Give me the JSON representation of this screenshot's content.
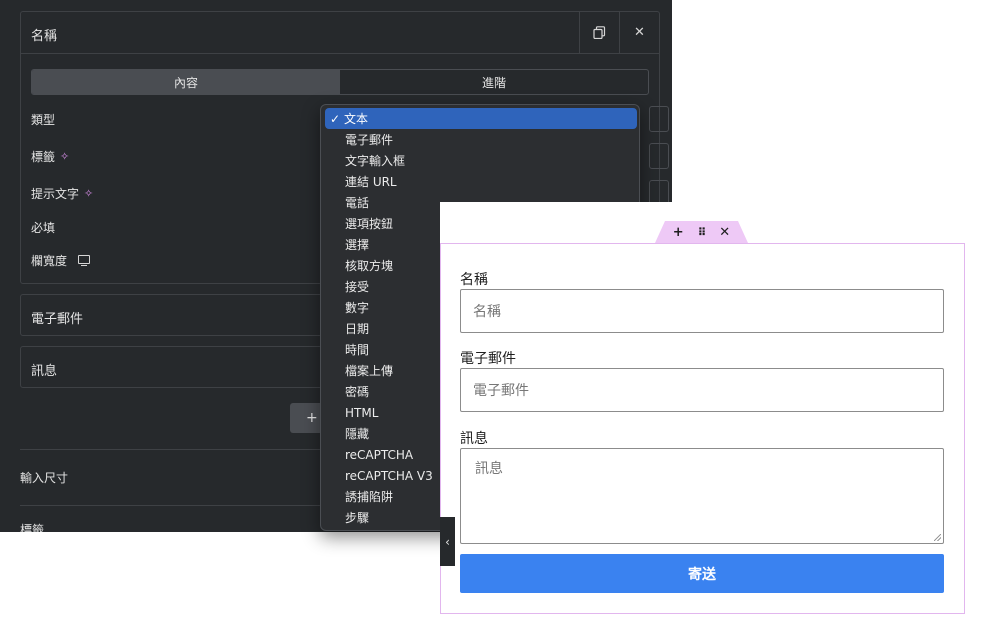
{
  "editor": {
    "field_title": "名稱",
    "tabs": [
      {
        "label": "內容",
        "active": true
      },
      {
        "label": "進階",
        "active": false
      }
    ],
    "rows": {
      "type_label": "類型",
      "label_label": "標籤",
      "placeholder_label": "提示文字",
      "required_label": "必填",
      "column_width_label": "欄寬度"
    },
    "collapsed_items": [
      "電子郵件",
      "訊息"
    ],
    "add_button": "+",
    "input_size_label": "輸入尺寸",
    "bottom_label": "標籤"
  },
  "dropdown": {
    "selected": "文本",
    "options": [
      "文本",
      "電子郵件",
      "文字輸入框",
      "連結 URL",
      "電話",
      "選項按鈕",
      "選擇",
      "核取方塊",
      "接受",
      "數字",
      "日期",
      "時間",
      "檔案上傳",
      "密碼",
      "HTML",
      "隱藏",
      "reCAPTCHA",
      "reCAPTCHA V3",
      "誘捕陷阱",
      "步驟"
    ]
  },
  "preview": {
    "toolbar": {
      "add": "+",
      "drag": "⠿",
      "close": "✕"
    },
    "fields": [
      {
        "label": "名稱",
        "placeholder": "名稱"
      },
      {
        "label": "電子郵件",
        "placeholder": "電子郵件"
      },
      {
        "label": "訊息",
        "placeholder": "訊息"
      }
    ],
    "submit_label": "寄送",
    "collapse_icon": "‹"
  },
  "colors": {
    "panel_bg": "#26292c",
    "selected_option": "#2f64bb",
    "frame_border": "#e2b6ee",
    "submit_bg": "#3a82f0"
  }
}
